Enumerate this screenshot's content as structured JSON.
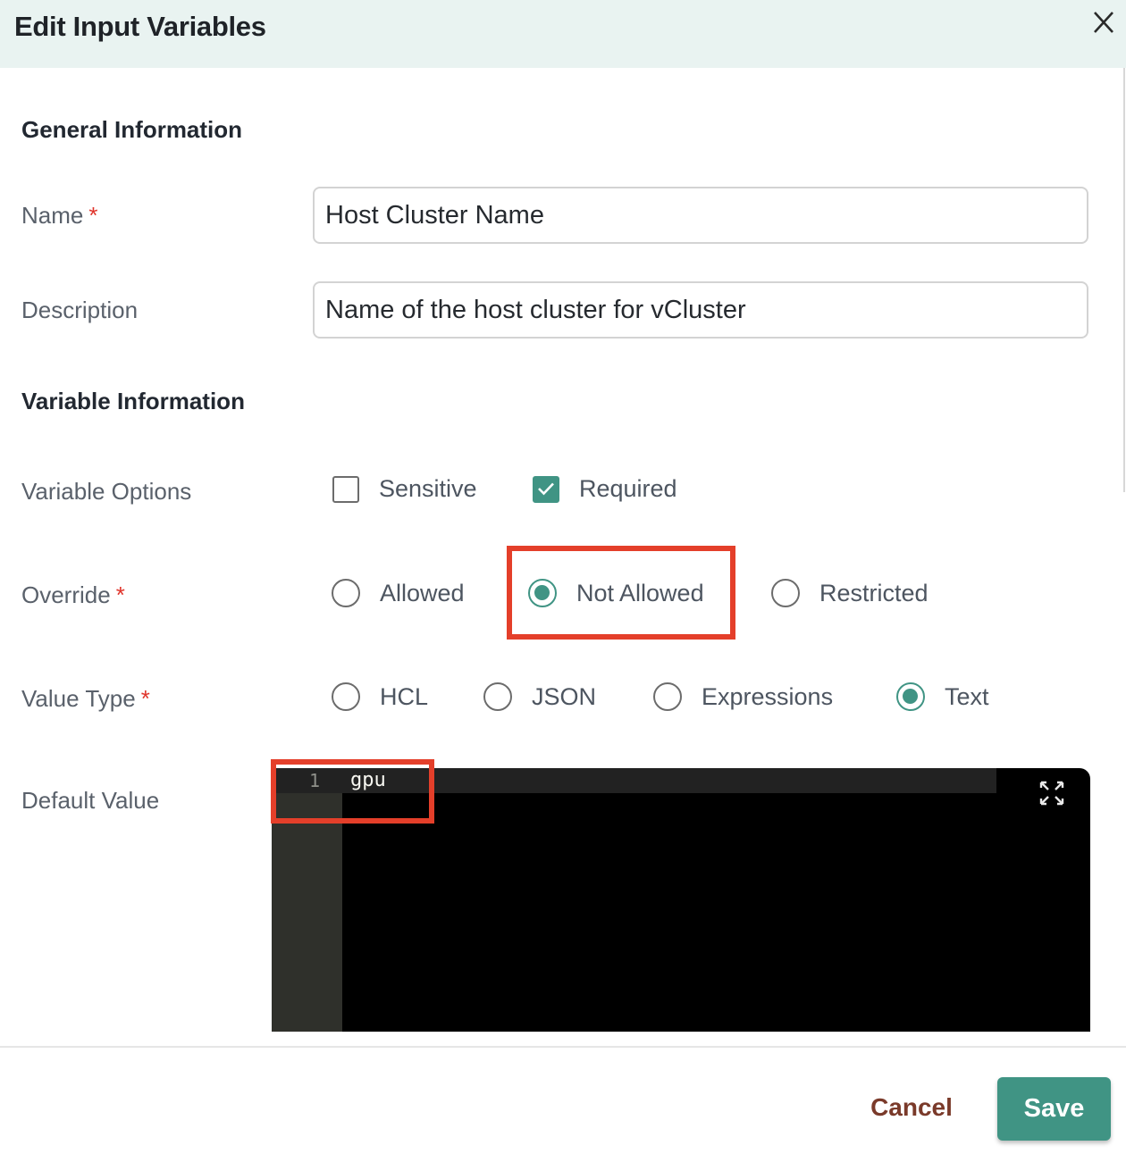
{
  "dialog": {
    "title": "Edit Input Variables",
    "close_icon": "close-icon"
  },
  "general_section": {
    "title": "General Information",
    "name": {
      "label": "Name",
      "required_mark": "*",
      "value": "Host Cluster Name"
    },
    "description": {
      "label": "Description",
      "value": "Name of the host cluster for vCluster"
    }
  },
  "variable_section": {
    "title": "Variable Information",
    "variable_options": {
      "label": "Variable Options",
      "options": [
        {
          "label": "Sensitive",
          "checked": false
        },
        {
          "label": "Required",
          "checked": true
        }
      ]
    },
    "override": {
      "label": "Override",
      "required_mark": "*",
      "options": [
        "Allowed",
        "Not Allowed",
        "Restricted"
      ],
      "selected": "Not Allowed"
    },
    "value_type": {
      "label": "Value Type",
      "required_mark": "*",
      "options": [
        "HCL",
        "JSON",
        "Expressions",
        "Text"
      ],
      "selected": "Text"
    },
    "default_value": {
      "label": "Default Value",
      "lines": [
        {
          "number": "1",
          "text": "gpu"
        }
      ],
      "expand_icon": "expand-icon"
    }
  },
  "footer": {
    "cancel_label": "Cancel",
    "save_label": "Save"
  },
  "colors": {
    "accent": "#409484",
    "header_bg": "#e9f3f1",
    "required": "#e0342b",
    "annotation": "#e43f2a",
    "cancel_text": "#7a3a2a"
  }
}
